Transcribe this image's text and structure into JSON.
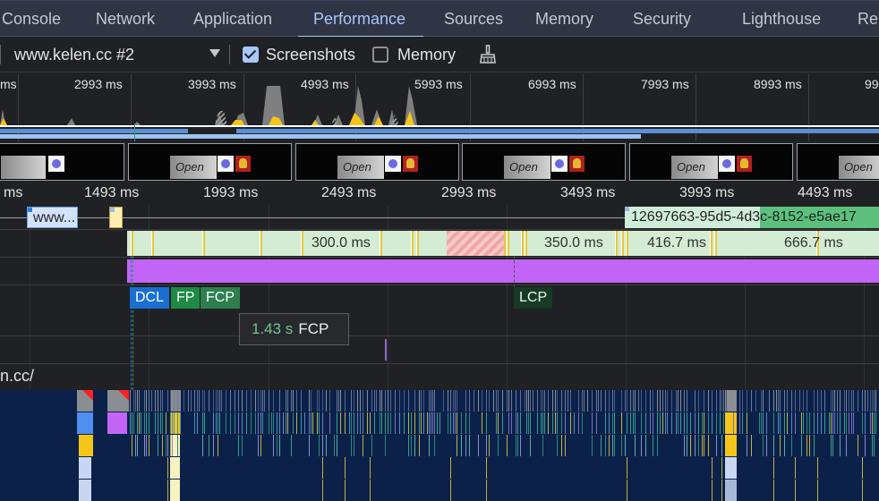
{
  "tabs": [
    {
      "label": "Console",
      "active": false
    },
    {
      "label": "Network",
      "active": false
    },
    {
      "label": "Application",
      "active": false
    },
    {
      "label": "Performance",
      "active": true
    },
    {
      "label": "Sources",
      "active": false
    },
    {
      "label": "Memory",
      "active": false
    },
    {
      "label": "Security",
      "active": false
    },
    {
      "label": "Lighthouse",
      "active": false
    },
    {
      "label": "Re",
      "active": false
    }
  ],
  "toolbar": {
    "recording_select": "www.kelen.cc #2",
    "screenshots_label": "Screenshots",
    "screenshots_checked": true,
    "memory_label": "Memory",
    "memory_checked": false,
    "clear_icon": "broom-icon"
  },
  "overview": {
    "tick_labels": [
      "ms",
      "2993 ms",
      "3993 ms",
      "4993 ms",
      "5993 ms",
      "6993 ms",
      "7993 ms",
      "8993 ms",
      "99"
    ]
  },
  "filmstrip": {
    "screenshot_text": "Open",
    "count": 6
  },
  "ruler": {
    "labels": [
      "ms",
      "1493 ms",
      "1993 ms",
      "2493 ms",
      "2993 ms",
      "3493 ms",
      "3993 ms",
      "4493 ms"
    ]
  },
  "network": {
    "request_1": "www...",
    "request_3": "12697663-95d5-4d3c-8152-e5ae17"
  },
  "frames": {
    "segments": [
      "300.0 ms",
      "350.0 ms",
      "416.7 ms",
      "666.7 ms"
    ]
  },
  "timings": {
    "dcl": "DCL",
    "fp": "FP",
    "fcp": "FCP",
    "lcp": "LCP"
  },
  "tooltip": {
    "value": "1.43 s",
    "name": "FCP"
  },
  "main_thread": {
    "label": "n.cc/"
  },
  "colors": {
    "accent": "#a8c7fa",
    "frames_bg": "#d4ecd3",
    "animation": "#c265f7",
    "dcl": "#1a6fd1",
    "fp": "#1e8a44",
    "fcp": "#2e7f4d",
    "flame_bg": "#0b214a",
    "scripting": "#f5c518",
    "rendering": "#c265f7"
  }
}
